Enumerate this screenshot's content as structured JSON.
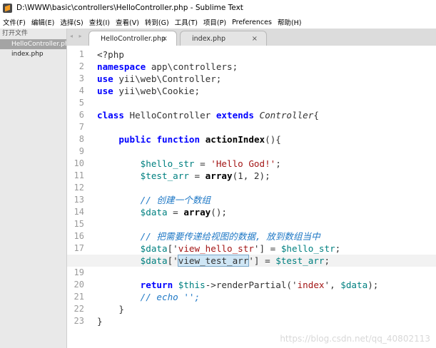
{
  "window": {
    "title": "D:\\WWW\\basic\\controllers\\HelloController.php - Sublime Text"
  },
  "menu": [
    "文件(F)",
    "编辑(E)",
    "选择(S)",
    "查找(I)",
    "查看(V)",
    "转到(G)",
    "工具(T)",
    "项目(P)",
    "Preferences",
    "帮助(H)"
  ],
  "sidebar": {
    "header": "打开文件",
    "files": [
      {
        "label": "HelloController.php",
        "selected": true
      },
      {
        "label": "index.php",
        "selected": false
      }
    ]
  },
  "tabs": [
    {
      "label": "HelloController.php",
      "active": true,
      "close": "×"
    },
    {
      "label": "index.php",
      "active": false,
      "close": "×"
    }
  ],
  "nav_arrows": "◂ ▸",
  "editor": {
    "current_line": 18,
    "lines": [
      [
        [
          "t-op",
          "<?php"
        ]
      ],
      [
        [
          "t-kw",
          "namespace"
        ],
        [
          "t-op",
          " app\\controllers;"
        ]
      ],
      [
        [
          "t-kw",
          "use"
        ],
        [
          "t-op",
          " yii\\web\\Controller;"
        ]
      ],
      [
        [
          "t-kw",
          "use"
        ],
        [
          "t-op",
          " yii\\web\\Cookie;"
        ]
      ],
      [],
      [
        [
          "t-kw",
          "class"
        ],
        [
          "t-op",
          " HelloController "
        ],
        [
          "t-kw",
          "extends"
        ],
        [
          "t-op",
          " "
        ],
        [
          "t-cls",
          "Controller"
        ],
        [
          "t-op",
          "{"
        ]
      ],
      [],
      [
        [
          "t-op",
          "    "
        ],
        [
          "t-kw",
          "public"
        ],
        [
          "t-op",
          " "
        ],
        [
          "t-kw",
          "function"
        ],
        [
          "t-op",
          " "
        ],
        [
          "t-fn",
          "actionIndex"
        ],
        [
          "t-op",
          "(){"
        ]
      ],
      [],
      [
        [
          "t-op",
          "        "
        ],
        [
          "t-var",
          "$hello_str"
        ],
        [
          "t-op",
          " = "
        ],
        [
          "t-str",
          "'Hello God!'"
        ],
        [
          "t-op",
          ";"
        ]
      ],
      [
        [
          "t-op",
          "        "
        ],
        [
          "t-var",
          "$test_arr"
        ],
        [
          "t-op",
          " = "
        ],
        [
          "t-fn",
          "array"
        ],
        [
          "t-op",
          "(1, 2);"
        ]
      ],
      [],
      [
        [
          "t-op",
          "        "
        ],
        [
          "t-cm",
          "// 创建一个数组"
        ]
      ],
      [
        [
          "t-op",
          "        "
        ],
        [
          "t-var",
          "$data"
        ],
        [
          "t-op",
          " = "
        ],
        [
          "t-fn",
          "array"
        ],
        [
          "t-op",
          "();"
        ]
      ],
      [],
      [
        [
          "t-op",
          "        "
        ],
        [
          "t-cm",
          "// 把需要传递给视图的数据, 放到数组当中"
        ]
      ],
      [
        [
          "t-op",
          "        "
        ],
        [
          "t-var",
          "$data"
        ],
        [
          "t-op",
          "['"
        ],
        [
          "t-str",
          "view_hello_str"
        ],
        [
          "t-op",
          "'] = "
        ],
        [
          "t-var",
          "$hello_str"
        ],
        [
          "t-op",
          ";"
        ]
      ],
      [
        [
          "t-op",
          "        "
        ],
        [
          "t-var",
          "$data"
        ],
        [
          "t-op",
          "['"
        ],
        [
          "t-hl",
          "view_test_arr"
        ],
        [
          "t-op",
          "'] = "
        ],
        [
          "t-var",
          "$test_arr"
        ],
        [
          "t-op",
          ";"
        ]
      ],
      [],
      [
        [
          "t-op",
          "        "
        ],
        [
          "t-kw",
          "return"
        ],
        [
          "t-op",
          " "
        ],
        [
          "t-var",
          "$this"
        ],
        [
          "t-op",
          "->renderPartial('"
        ],
        [
          "t-str",
          "index"
        ],
        [
          "t-op",
          "', "
        ],
        [
          "t-var",
          "$data"
        ],
        [
          "t-op",
          ");"
        ]
      ],
      [
        [
          "t-op",
          "        "
        ],
        [
          "t-cm",
          "// echo '';"
        ]
      ],
      [
        [
          "t-op",
          "    }"
        ]
      ],
      [
        [
          "t-op",
          "}"
        ]
      ]
    ]
  },
  "watermark": "https://blog.csdn.net/qq_40802113"
}
